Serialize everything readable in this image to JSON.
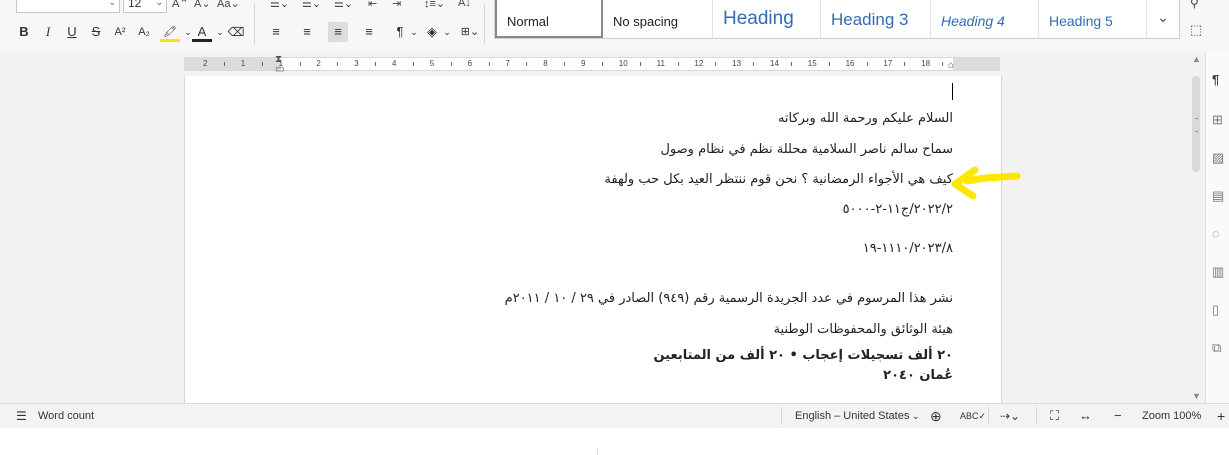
{
  "ribbon": {
    "font_name_value": "",
    "font_size_value": "12",
    "font_tools": [
      {
        "icon": "bold-icon",
        "glyph": "B"
      },
      {
        "icon": "italic-icon",
        "glyph": "I"
      },
      {
        "icon": "underline-icon",
        "glyph": "U"
      },
      {
        "icon": "strikethrough-icon",
        "glyph": "S"
      },
      {
        "icon": "superscript-icon",
        "glyph": "A²"
      },
      {
        "icon": "subscript-icon",
        "glyph": "A₂"
      },
      {
        "icon": "highlight-icon",
        "glyph": "🖍"
      },
      {
        "icon": "font-color-icon",
        "glyph": "A"
      },
      {
        "icon": "clear-formatting-icon",
        "glyph": "⌫"
      }
    ],
    "paragraph_tools": [
      {
        "icon": "align-left-icon",
        "glyph": "≡"
      },
      {
        "icon": "align-center-icon",
        "glyph": "≡"
      },
      {
        "icon": "align-right-icon",
        "glyph": "≡",
        "selected": true
      },
      {
        "icon": "justify-icon",
        "glyph": "≡"
      },
      {
        "icon": "text-direction-icon",
        "glyph": "¶"
      },
      {
        "icon": "shading-icon",
        "glyph": "◈"
      }
    ],
    "styles": [
      {
        "label": "Normal",
        "color": "#222222"
      },
      {
        "label": "No spacing",
        "color": "#222222"
      },
      {
        "label": "Heading",
        "color": "#2f6db5"
      },
      {
        "label": "Heading 3",
        "color": "#2f6db5"
      },
      {
        "label": "Heading 4",
        "color": "#2f6db5"
      },
      {
        "label": "Heading 5",
        "color": "#2f6db5"
      }
    ],
    "styles_more_icon": "chevron-down-icon"
  },
  "ruler": {
    "numbers": [
      "2",
      "1",
      "1",
      "2",
      "3",
      "4",
      "5",
      "6",
      "7",
      "8",
      "9",
      "10",
      "11",
      "12",
      "13",
      "14",
      "15",
      "16",
      "17",
      "18"
    ]
  },
  "document": {
    "lines": [
      {
        "text": "السلام عليكم ورحمة الله وبركاته",
        "bold": false
      },
      {
        "text": "سماح سالم ناصر السلامية محللة نظم في نظام وصول",
        "bold": false
      },
      {
        "text": "كيف هي الأجواء الرمضانية ؟ نحن قوم ننتظر العيد بكل حب ولهفة",
        "bold": false
      },
      {
        "text": "٢٠٢٢/٢/ج١١-٢-٥٠٠٠",
        "bold": false
      },
      {
        "text": "١١١٠/٢٠٢٣/٨-١٩",
        "bold": false
      },
      {
        "text": "نشر هذا المرسوم في عدد الجريدة الرسمية رقم (٩٤٩) الصادر في ٢٩ / ١٠ / ٢٠١١م",
        "bold": false
      },
      {
        "text": "هيئة الوثائق والمحفوظات الوطنية",
        "bold": false
      },
      {
        "text": "٢٠ ألف تسجيلات إعجاب • ٢٠ ألف من المتابعين",
        "bold": true
      },
      {
        "text": "عُمان ٢٠٤٠",
        "bold": true
      }
    ],
    "annotation_arrow_color": "#ffe600"
  },
  "status_bar": {
    "word_count": "Word count",
    "language": "English – United States",
    "zoom": "Zoom 100%"
  }
}
